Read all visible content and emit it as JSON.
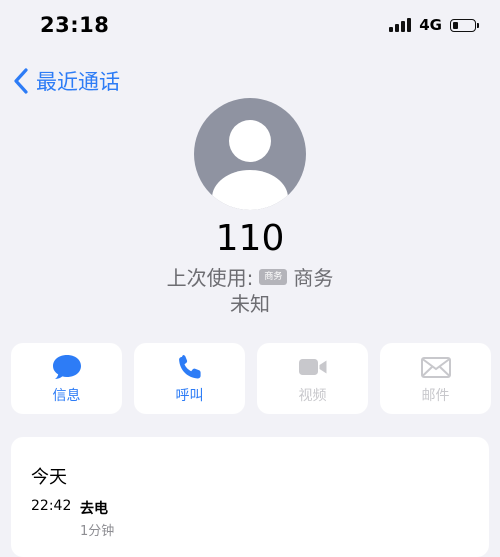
{
  "status_bar": {
    "time": "23:18",
    "network": "4G"
  },
  "nav": {
    "back_label": "最近通话"
  },
  "contact": {
    "number": "110",
    "last_used_label": "上次使用:",
    "last_used_tag": "商务",
    "last_used_value": "商务",
    "location": "未知"
  },
  "actions": [
    {
      "label": "信息",
      "icon": "message-icon",
      "enabled": true
    },
    {
      "label": "呼叫",
      "icon": "phone-icon",
      "enabled": true
    },
    {
      "label": "视频",
      "icon": "video-icon",
      "enabled": false
    },
    {
      "label": "邮件",
      "icon": "mail-icon",
      "enabled": false
    }
  ],
  "history": {
    "title": "今天",
    "entries": [
      {
        "time": "22:42",
        "type": "去电",
        "duration": "1分钟"
      }
    ]
  },
  "colors": {
    "accent": "#2d7cf6",
    "background": "#f2f2f7",
    "disabled": "#c8c8cc",
    "avatar": "#8f93a1"
  }
}
